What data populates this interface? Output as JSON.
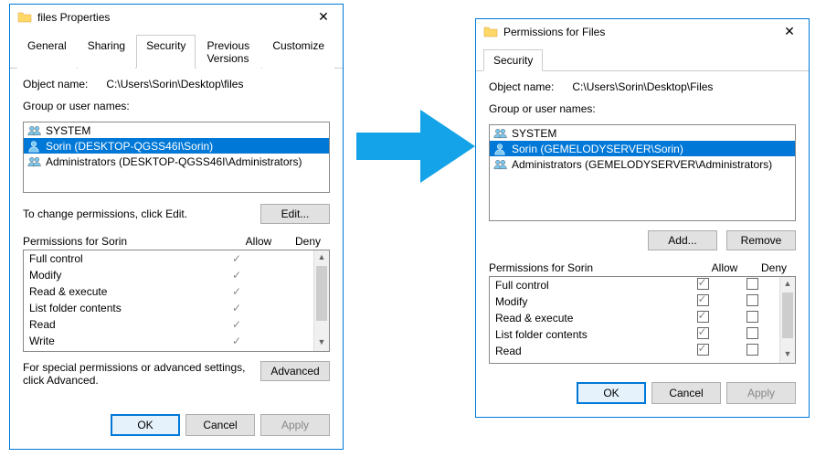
{
  "left": {
    "title": "files Properties",
    "tabs": [
      "General",
      "Sharing",
      "Security",
      "Previous Versions",
      "Customize"
    ],
    "activeTabIndex": 2,
    "objectNameLabel": "Object name:",
    "objectName": "C:\\Users\\Sorin\\Desktop\\files",
    "groupsLabel": "Group or user names:",
    "users": [
      {
        "name": "SYSTEM",
        "type": "group",
        "selected": false
      },
      {
        "name": "Sorin (DESKTOP-QGSS46I\\Sorin)",
        "type": "user",
        "selected": true
      },
      {
        "name": "Administrators (DESKTOP-QGSS46I\\Administrators)",
        "type": "group",
        "selected": false
      }
    ],
    "changePermsText": "To change permissions, click Edit.",
    "editButton": "Edit...",
    "permsForLabel": "Permissions for Sorin",
    "allowLabel": "Allow",
    "denyLabel": "Deny",
    "perms": [
      {
        "name": "Full control",
        "allow": true,
        "deny": false
      },
      {
        "name": "Modify",
        "allow": true,
        "deny": false
      },
      {
        "name": "Read & execute",
        "allow": true,
        "deny": false
      },
      {
        "name": "List folder contents",
        "allow": true,
        "deny": false
      },
      {
        "name": "Read",
        "allow": true,
        "deny": false
      },
      {
        "name": "Write",
        "allow": true,
        "deny": false
      }
    ],
    "advancedText": "For special permissions or advanced settings, click Advanced.",
    "advancedButton": "Advanced",
    "ok": "OK",
    "cancel": "Cancel",
    "apply": "Apply"
  },
  "right": {
    "title": "Permissions for Files",
    "tab": "Security",
    "objectNameLabel": "Object name:",
    "objectName": "C:\\Users\\Sorin\\Desktop\\Files",
    "groupsLabel": "Group or user names:",
    "users": [
      {
        "name": "SYSTEM",
        "type": "group",
        "selected": false
      },
      {
        "name": "Sorin (GEMELODYSERVER\\Sorin)",
        "type": "user",
        "selected": true
      },
      {
        "name": "Administrators (GEMELODYSERVER\\Administrators)",
        "type": "group",
        "selected": false
      }
    ],
    "addButton": "Add...",
    "removeButton": "Remove",
    "permsForLabel": "Permissions for Sorin",
    "allowLabel": "Allow",
    "denyLabel": "Deny",
    "perms": [
      {
        "name": "Full control",
        "allow": true,
        "deny": false
      },
      {
        "name": "Modify",
        "allow": true,
        "deny": false
      },
      {
        "name": "Read & execute",
        "allow": true,
        "deny": false
      },
      {
        "name": "List folder contents",
        "allow": true,
        "deny": false
      },
      {
        "name": "Read",
        "allow": true,
        "deny": false
      }
    ],
    "ok": "OK",
    "cancel": "Cancel",
    "apply": "Apply"
  }
}
